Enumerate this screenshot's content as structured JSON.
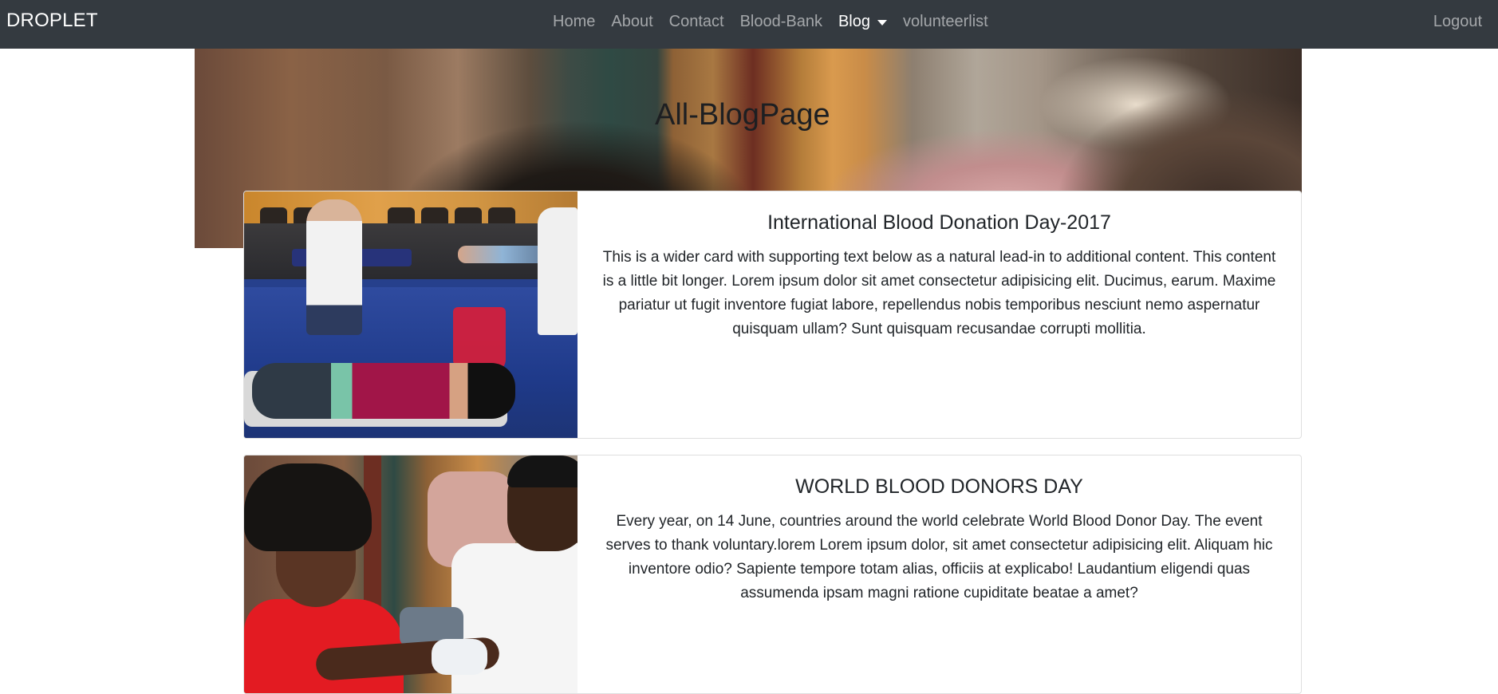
{
  "navbar": {
    "brand": "DROPLET",
    "links": [
      {
        "label": "Home"
      },
      {
        "label": "About"
      },
      {
        "label": "Contact"
      },
      {
        "label": "Blood-Bank"
      },
      {
        "label": "Blog",
        "active": true,
        "dropdown": true
      },
      {
        "label": "volunteerlist"
      }
    ],
    "logout": "Logout"
  },
  "hero": {
    "title": "All-BlogPage"
  },
  "posts": [
    {
      "title": "International Blood Donation Day-2017",
      "text": "This is a wider card with supporting text below as a natural lead-in to additional content. This content is a little bit longer. Lorem ipsum dolor sit amet consectetur adipisicing elit. Ducimus, earum. Maxime pariatur ut fugit inventore fugiat labore, repellendus nobis temporibus nesciunt nemo aspernatur quisquam ullam? Sunt quisquam recusandae corrupti mollitia."
    },
    {
      "title": "WORLD BLOOD DONORS DAY",
      "text": "Every year, on 14 June, countries around the world celebrate World Blood Donor Day. The event serves to thank voluntary.lorem Lorem ipsum dolor, sit amet consectetur adipisicing elit. Aliquam hic inventore odio? Sapiente tempore totam alias, officiis at explicabo! Laudantium eligendi quas assumenda ipsam magni ratione cupiditate beatae a amet?"
    }
  ],
  "colors": {
    "navbar_bg": "#343a40",
    "nav_link": "#9a9da0",
    "nav_active": "#ffffff"
  }
}
